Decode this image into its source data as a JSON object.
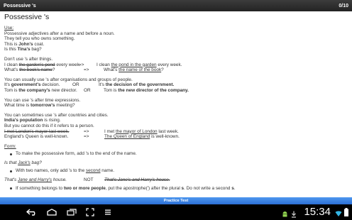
{
  "titlebar": {
    "title": "Possessive 's",
    "progress": "0/10"
  },
  "lesson": {
    "heading": "Possessive 's",
    "use_label": "Use:",
    "intro1": "Possessive adjectives after a name and before a noun.",
    "intro2": "They tell you who owns something.",
    "ex1_pre": "This is ",
    "ex1_b": "John's",
    "ex1_post": " coat.",
    "ex2_pre": "Is this ",
    "ex2_b": "Tina's",
    "ex2_post": " bag?",
    "things_line": "Don't use 's after things.",
    "t1_pre": "I clean ",
    "t1_strike": "the garden's pond",
    "t1_post": " every week.",
    "arrow": "=>",
    "t1r_pre": "I clean ",
    "t1r_u": "the pond in the garden",
    "t1r_post": " every week.",
    "t2_pre": "What's ",
    "t2_strike": "the book's name",
    "t2_post": "?",
    "t2r_pre": "What's ",
    "t2r_u": "the name of the book",
    "t2r_post": "?",
    "org_line": "You can usually use 's after organisations and groups of people.",
    "o1_pre": "It's ",
    "o1_b": "government's",
    "o1_post": " decision.",
    "or": "OR",
    "o1r_pre": "It's ",
    "o1r_b": "the decision of the government.",
    "o2_pre": "Tom is ",
    "o2_b": "the company's",
    "o2_post": " new  director.",
    "o2r_pre": "Tom is ",
    "o2r_b": "the new director of the company.",
    "time_line": "You can use 's after time expressions.",
    "time_ex_pre": "What time is ",
    "time_ex_b": "tomorrow's",
    "time_ex_post": " meeting?",
    "country_line": "You can sometimes use 's after countries and cities.",
    "c1_b": "India's population",
    "c1_post": " is rising.",
    "c2": "But you cannot do this if it refers to a person.",
    "c3_strike": "I met London's mayor last week.",
    "c3r_pre": "I met ",
    "c3r_u": "the mayor of London",
    "c3r_post": " last week.",
    "c4": "England's Queen is well-known.",
    "c4r_u": "The Queen of England",
    "c4r_post": " is well-known.",
    "form_label": "Form:",
    "f1": "To make the possessive form, add 's to the end of the name.",
    "f1_ex_pre": "Is that ",
    "f1_ex_u": "Jack's",
    "f1_ex_post": " bag?",
    "f2_pre": "With two names, only add 's to the ",
    "f2_u": "second",
    "f2_post": " name.",
    "f2_ex_pre": "That's ",
    "f2_ex_u": "Jane and Harry's",
    "f2_ex_post": " house.",
    "not": "NOT",
    "f2_wrong": "That's Jane's and Harry's house.",
    "f3_pre": "If something belongs to ",
    "f3_b": "two or more people",
    "f3_mid": ", put the apostrophe(') after the plural ",
    "f3_s": "s",
    "f3_post": ". Do not write a second ",
    "f3_s2": "s",
    "f3_end": "."
  },
  "practice_button": "Practice Test",
  "status": {
    "time": "15:34"
  },
  "icons": [
    "back-icon",
    "home-icon",
    "recent-apps-icon",
    "screenshot-icon",
    "menu-icon",
    "android-icon",
    "download-icon",
    "wifi-icon",
    "battery-icon"
  ]
}
